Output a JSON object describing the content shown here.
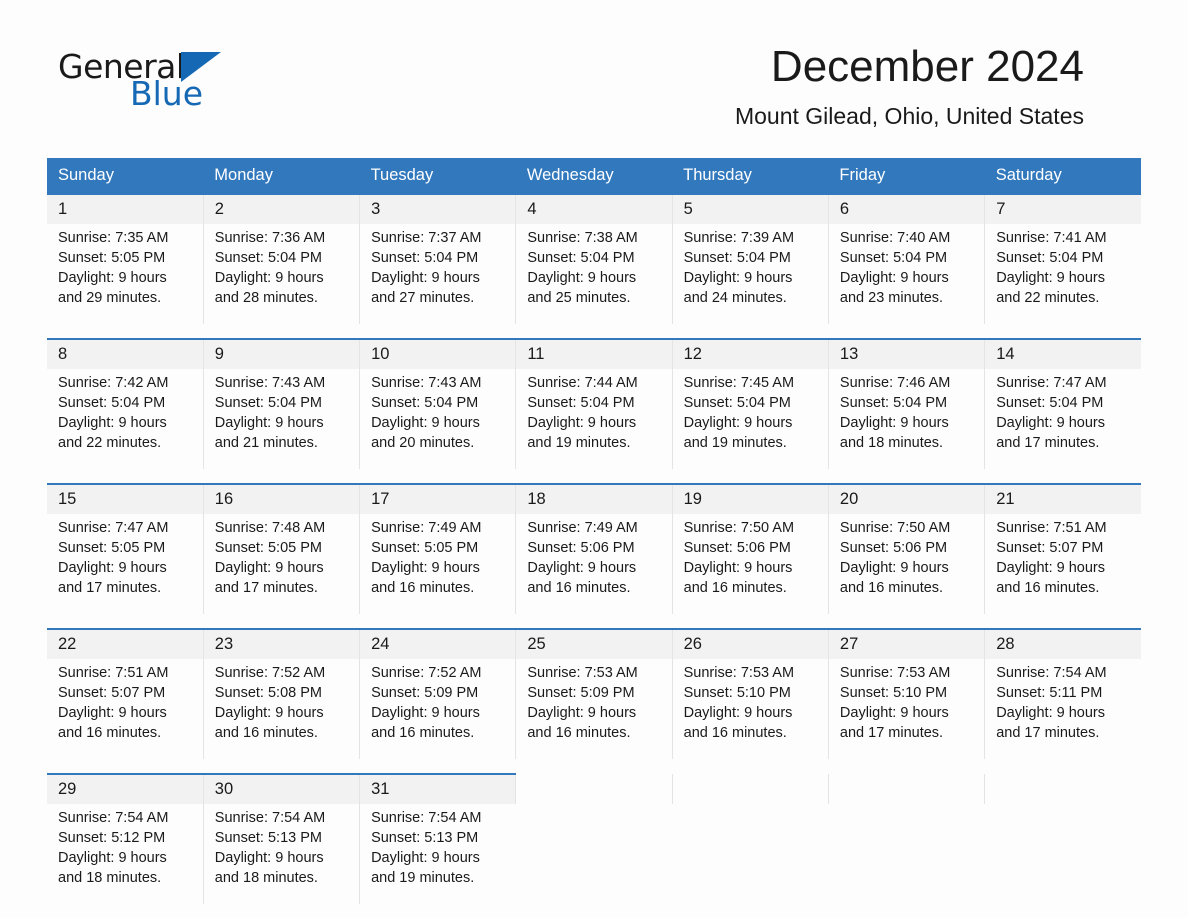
{
  "brand": {
    "name_part1": "General",
    "name_part2": "Blue",
    "accent_color": "#1569b4"
  },
  "header": {
    "title": "December 2024",
    "subtitle": "Mount Gilead, Ohio, United States"
  },
  "calendar": {
    "header_bg": "#3278bd",
    "date_band_bg": "#f2f2f2",
    "weekdays": [
      "Sunday",
      "Monday",
      "Tuesday",
      "Wednesday",
      "Thursday",
      "Friday",
      "Saturday"
    ],
    "weeks": [
      [
        {
          "date": "1",
          "sunrise": "Sunrise: 7:35 AM",
          "sunset": "Sunset: 5:05 PM",
          "daylight1": "Daylight: 9 hours",
          "daylight2": "and 29 minutes."
        },
        {
          "date": "2",
          "sunrise": "Sunrise: 7:36 AM",
          "sunset": "Sunset: 5:04 PM",
          "daylight1": "Daylight: 9 hours",
          "daylight2": "and 28 minutes."
        },
        {
          "date": "3",
          "sunrise": "Sunrise: 7:37 AM",
          "sunset": "Sunset: 5:04 PM",
          "daylight1": "Daylight: 9 hours",
          "daylight2": "and 27 minutes."
        },
        {
          "date": "4",
          "sunrise": "Sunrise: 7:38 AM",
          "sunset": "Sunset: 5:04 PM",
          "daylight1": "Daylight: 9 hours",
          "daylight2": "and 25 minutes."
        },
        {
          "date": "5",
          "sunrise": "Sunrise: 7:39 AM",
          "sunset": "Sunset: 5:04 PM",
          "daylight1": "Daylight: 9 hours",
          "daylight2": "and 24 minutes."
        },
        {
          "date": "6",
          "sunrise": "Sunrise: 7:40 AM",
          "sunset": "Sunset: 5:04 PM",
          "daylight1": "Daylight: 9 hours",
          "daylight2": "and 23 minutes."
        },
        {
          "date": "7",
          "sunrise": "Sunrise: 7:41 AM",
          "sunset": "Sunset: 5:04 PM",
          "daylight1": "Daylight: 9 hours",
          "daylight2": "and 22 minutes."
        }
      ],
      [
        {
          "date": "8",
          "sunrise": "Sunrise: 7:42 AM",
          "sunset": "Sunset: 5:04 PM",
          "daylight1": "Daylight: 9 hours",
          "daylight2": "and 22 minutes."
        },
        {
          "date": "9",
          "sunrise": "Sunrise: 7:43 AM",
          "sunset": "Sunset: 5:04 PM",
          "daylight1": "Daylight: 9 hours",
          "daylight2": "and 21 minutes."
        },
        {
          "date": "10",
          "sunrise": "Sunrise: 7:43 AM",
          "sunset": "Sunset: 5:04 PM",
          "daylight1": "Daylight: 9 hours",
          "daylight2": "and 20 minutes."
        },
        {
          "date": "11",
          "sunrise": "Sunrise: 7:44 AM",
          "sunset": "Sunset: 5:04 PM",
          "daylight1": "Daylight: 9 hours",
          "daylight2": "and 19 minutes."
        },
        {
          "date": "12",
          "sunrise": "Sunrise: 7:45 AM",
          "sunset": "Sunset: 5:04 PM",
          "daylight1": "Daylight: 9 hours",
          "daylight2": "and 19 minutes."
        },
        {
          "date": "13",
          "sunrise": "Sunrise: 7:46 AM",
          "sunset": "Sunset: 5:04 PM",
          "daylight1": "Daylight: 9 hours",
          "daylight2": "and 18 minutes."
        },
        {
          "date": "14",
          "sunrise": "Sunrise: 7:47 AM",
          "sunset": "Sunset: 5:04 PM",
          "daylight1": "Daylight: 9 hours",
          "daylight2": "and 17 minutes."
        }
      ],
      [
        {
          "date": "15",
          "sunrise": "Sunrise: 7:47 AM",
          "sunset": "Sunset: 5:05 PM",
          "daylight1": "Daylight: 9 hours",
          "daylight2": "and 17 minutes."
        },
        {
          "date": "16",
          "sunrise": "Sunrise: 7:48 AM",
          "sunset": "Sunset: 5:05 PM",
          "daylight1": "Daylight: 9 hours",
          "daylight2": "and 17 minutes."
        },
        {
          "date": "17",
          "sunrise": "Sunrise: 7:49 AM",
          "sunset": "Sunset: 5:05 PM",
          "daylight1": "Daylight: 9 hours",
          "daylight2": "and 16 minutes."
        },
        {
          "date": "18",
          "sunrise": "Sunrise: 7:49 AM",
          "sunset": "Sunset: 5:06 PM",
          "daylight1": "Daylight: 9 hours",
          "daylight2": "and 16 minutes."
        },
        {
          "date": "19",
          "sunrise": "Sunrise: 7:50 AM",
          "sunset": "Sunset: 5:06 PM",
          "daylight1": "Daylight: 9 hours",
          "daylight2": "and 16 minutes."
        },
        {
          "date": "20",
          "sunrise": "Sunrise: 7:50 AM",
          "sunset": "Sunset: 5:06 PM",
          "daylight1": "Daylight: 9 hours",
          "daylight2": "and 16 minutes."
        },
        {
          "date": "21",
          "sunrise": "Sunrise: 7:51 AM",
          "sunset": "Sunset: 5:07 PM",
          "daylight1": "Daylight: 9 hours",
          "daylight2": "and 16 minutes."
        }
      ],
      [
        {
          "date": "22",
          "sunrise": "Sunrise: 7:51 AM",
          "sunset": "Sunset: 5:07 PM",
          "daylight1": "Daylight: 9 hours",
          "daylight2": "and 16 minutes."
        },
        {
          "date": "23",
          "sunrise": "Sunrise: 7:52 AM",
          "sunset": "Sunset: 5:08 PM",
          "daylight1": "Daylight: 9 hours",
          "daylight2": "and 16 minutes."
        },
        {
          "date": "24",
          "sunrise": "Sunrise: 7:52 AM",
          "sunset": "Sunset: 5:09 PM",
          "daylight1": "Daylight: 9 hours",
          "daylight2": "and 16 minutes."
        },
        {
          "date": "25",
          "sunrise": "Sunrise: 7:53 AM",
          "sunset": "Sunset: 5:09 PM",
          "daylight1": "Daylight: 9 hours",
          "daylight2": "and 16 minutes."
        },
        {
          "date": "26",
          "sunrise": "Sunrise: 7:53 AM",
          "sunset": "Sunset: 5:10 PM",
          "daylight1": "Daylight: 9 hours",
          "daylight2": "and 16 minutes."
        },
        {
          "date": "27",
          "sunrise": "Sunrise: 7:53 AM",
          "sunset": "Sunset: 5:10 PM",
          "daylight1": "Daylight: 9 hours",
          "daylight2": "and 17 minutes."
        },
        {
          "date": "28",
          "sunrise": "Sunrise: 7:54 AM",
          "sunset": "Sunset: 5:11 PM",
          "daylight1": "Daylight: 9 hours",
          "daylight2": "and 17 minutes."
        }
      ],
      [
        {
          "date": "29",
          "sunrise": "Sunrise: 7:54 AM",
          "sunset": "Sunset: 5:12 PM",
          "daylight1": "Daylight: 9 hours",
          "daylight2": "and 18 minutes."
        },
        {
          "date": "30",
          "sunrise": "Sunrise: 7:54 AM",
          "sunset": "Sunset: 5:13 PM",
          "daylight1": "Daylight: 9 hours",
          "daylight2": "and 18 minutes."
        },
        {
          "date": "31",
          "sunrise": "Sunrise: 7:54 AM",
          "sunset": "Sunset: 5:13 PM",
          "daylight1": "Daylight: 9 hours",
          "daylight2": "and 19 minutes."
        },
        {
          "date": "",
          "sunrise": "",
          "sunset": "",
          "daylight1": "",
          "daylight2": ""
        },
        {
          "date": "",
          "sunrise": "",
          "sunset": "",
          "daylight1": "",
          "daylight2": ""
        },
        {
          "date": "",
          "sunrise": "",
          "sunset": "",
          "daylight1": "",
          "daylight2": ""
        },
        {
          "date": "",
          "sunrise": "",
          "sunset": "",
          "daylight1": "",
          "daylight2": ""
        }
      ]
    ]
  }
}
